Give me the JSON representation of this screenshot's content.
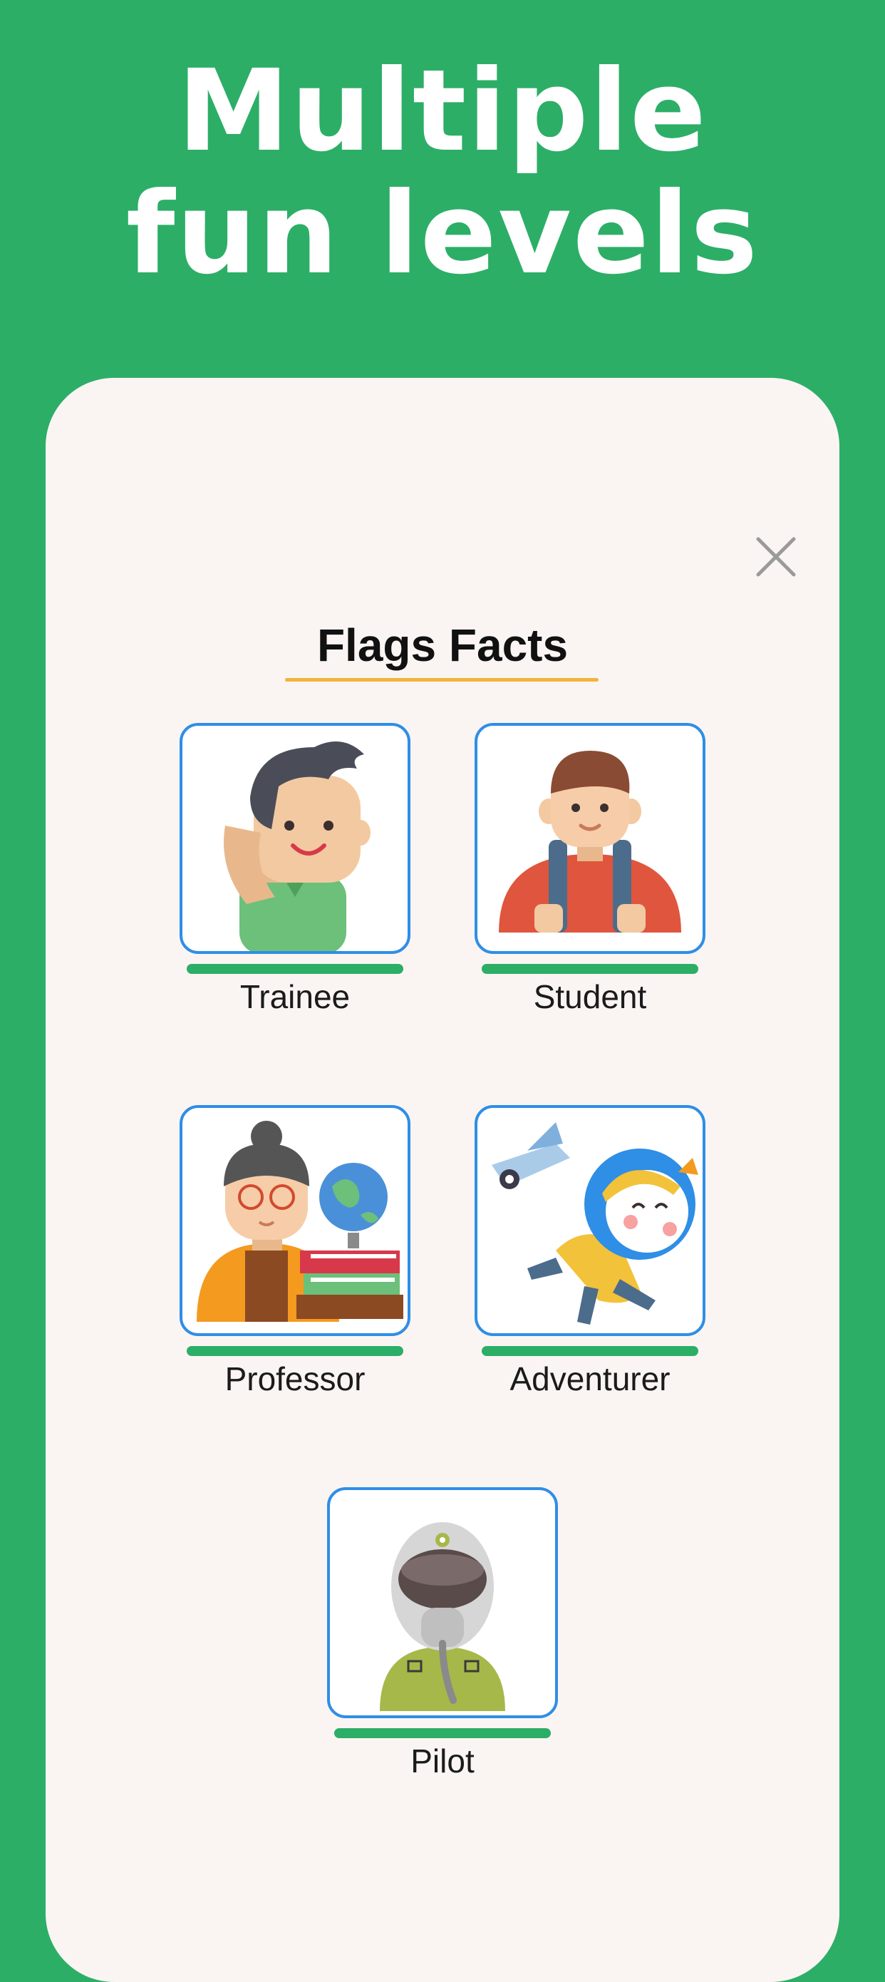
{
  "headline": {
    "line1": "Multiple",
    "line2": "fun levels"
  },
  "dialog": {
    "title": "Flags Facts",
    "colors": {
      "accent_underline": "#f0b43c",
      "tile_border": "#2f8ee6",
      "progress": "#2cae67",
      "background": "#2cae67"
    },
    "levels": [
      {
        "label": "Trainee",
        "icon": "trainee-avatar-icon",
        "progress": 1.0
      },
      {
        "label": "Student",
        "icon": "student-avatar-icon",
        "progress": 1.0
      },
      {
        "label": "Professor",
        "icon": "professor-avatar-icon",
        "progress": 1.0
      },
      {
        "label": "Adventurer",
        "icon": "adventurer-avatar-icon",
        "progress": 1.0
      },
      {
        "label": "Pilot",
        "icon": "pilot-avatar-icon",
        "progress": 1.0
      }
    ]
  }
}
